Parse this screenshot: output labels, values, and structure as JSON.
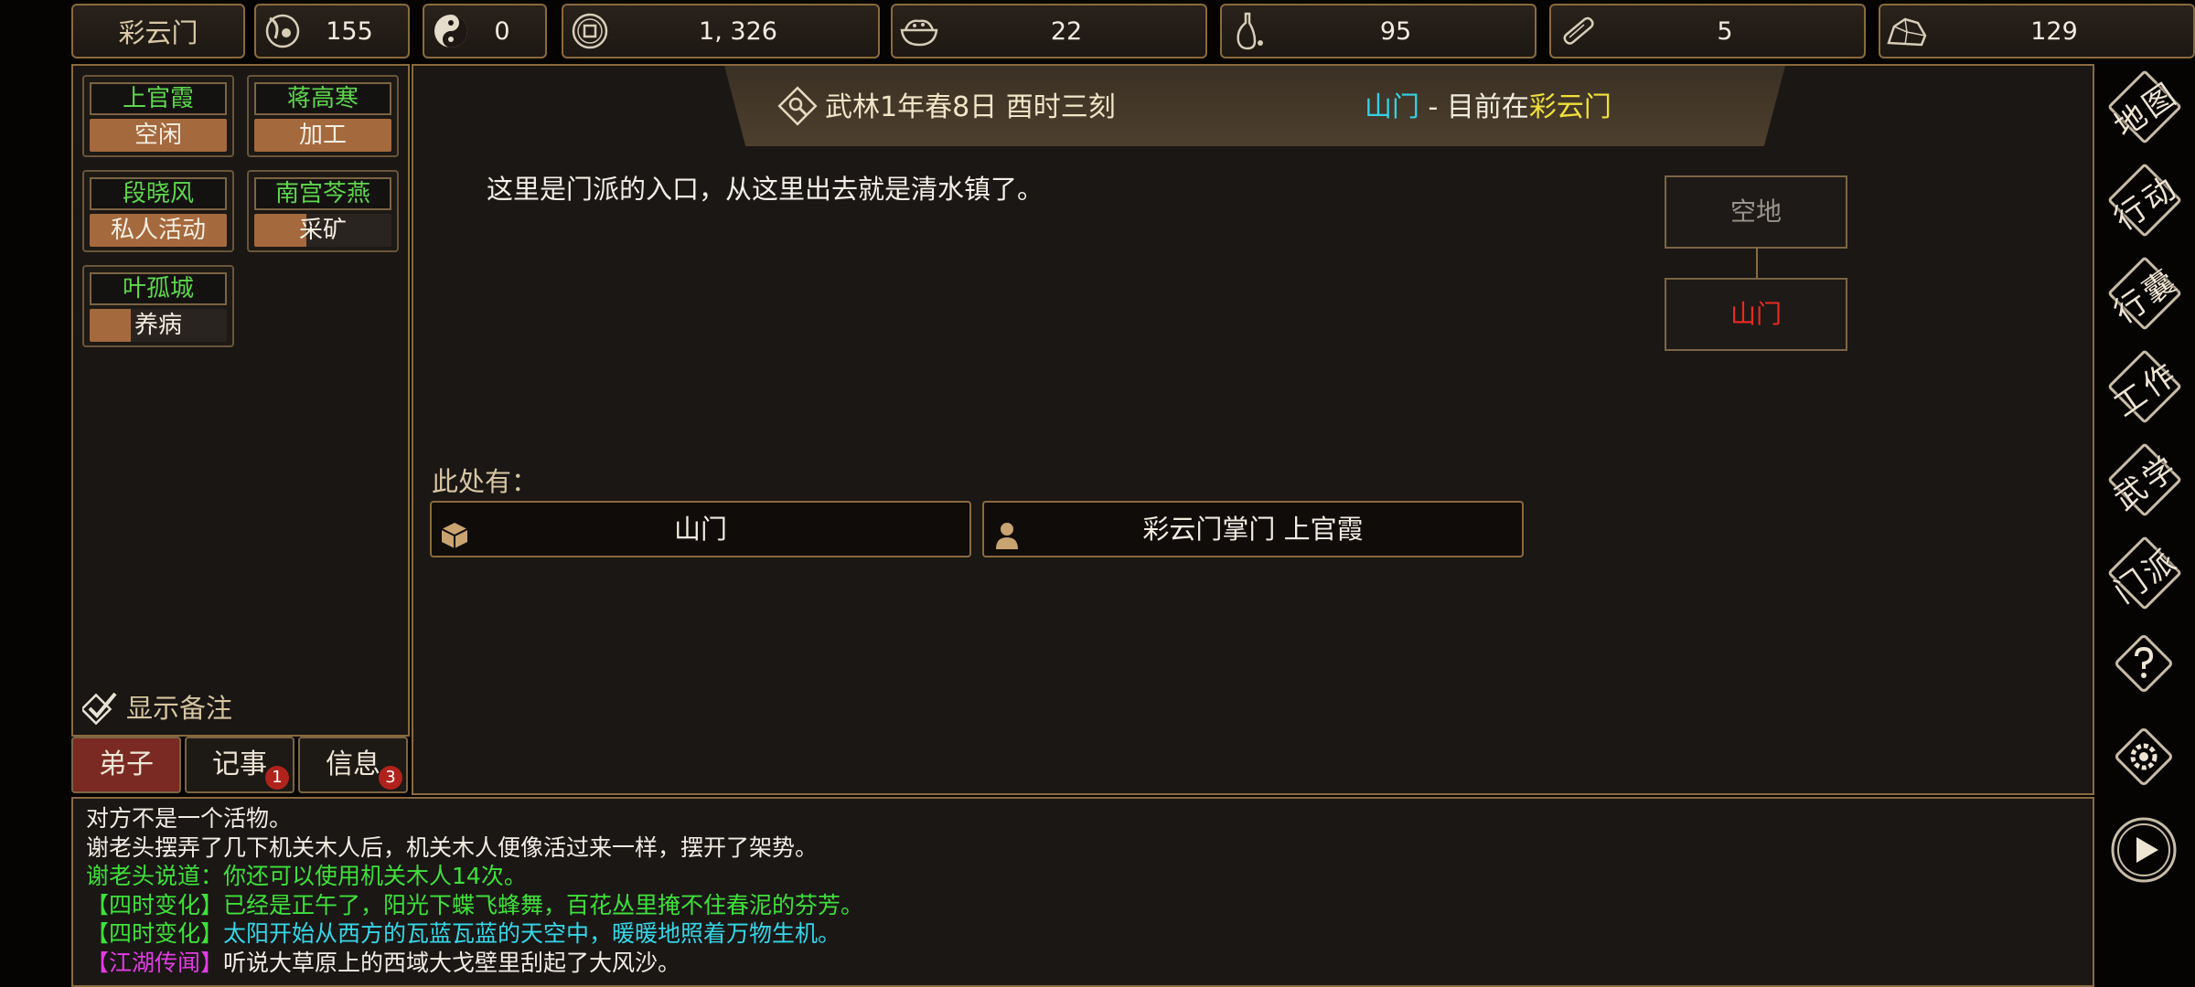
{
  "top_bar": {
    "sect_name": "彩云门",
    "resources": [
      {
        "icon": "prestige-icon",
        "value": "155"
      },
      {
        "icon": "yin-yang-icon",
        "value": "0"
      },
      {
        "icon": "coin-icon",
        "value": "1, 326"
      },
      {
        "icon": "food-bowl-icon",
        "value": "22"
      },
      {
        "icon": "herb-gourd-icon",
        "value": "95"
      },
      {
        "icon": "wood-log-icon",
        "value": "5"
      },
      {
        "icon": "ore-stone-icon",
        "value": "129"
      }
    ]
  },
  "disciples": [
    {
      "name": "上官霞",
      "task": "空闲"
    },
    {
      "name": "蒋高寒",
      "task": "加工"
    },
    {
      "name": "段晓风",
      "task": "私人活动"
    },
    {
      "name": "南宫芩燕",
      "task": "采矿"
    },
    {
      "name": "叶孤城",
      "task": "养病"
    }
  ],
  "show_notes_label": "显示备注",
  "bottom_tabs": [
    {
      "label": "弟子",
      "badge": ""
    },
    {
      "label": "记事",
      "badge": "1"
    },
    {
      "label": "信息",
      "badge": "3"
    }
  ],
  "banner": {
    "time": "武林1年春8日 酉时三刻",
    "location": "山门",
    "separator": " - 目前在",
    "sect": "彩云门"
  },
  "description": "这里是门派的入口，从这里出去就是清水镇了。",
  "mini_map": {
    "upper": "空地",
    "current": "山门"
  },
  "here_label": "此处有：",
  "entities": [
    {
      "label": "山门",
      "icon": "box-icon"
    },
    {
      "label": "彩云门掌门 上官霞",
      "icon": "person-icon"
    }
  ],
  "log": [
    {
      "segments": [
        {
          "text": "对方不是一个活物。",
          "color": "#f2ede3"
        }
      ]
    },
    {
      "segments": [
        {
          "text": "谢老头摆弄了几下机关木人后，机关木人便像活过来一样，摆开了架势。",
          "color": "#f2ede3"
        }
      ]
    },
    {
      "segments": [
        {
          "text": "谢老头说道：你还可以使用机关木人14次。",
          "color": "#3fe03a"
        }
      ]
    },
    {
      "segments": [
        {
          "text": "【四时变化】已经是正午了，阳光下蝶飞蜂舞，百花丛里掩不住春泥的芬芳。",
          "color": "#3fe03a"
        }
      ]
    },
    {
      "segments": [
        {
          "text": "【四时变化】",
          "color": "#3fe03a"
        },
        {
          "text": "太阳开始从西方的瓦蓝瓦蓝的天空中，暖暖地照着万物生机。",
          "color": "#35d7e8"
        }
      ]
    },
    {
      "segments": [
        {
          "text": "【江湖传闻】",
          "color": "#e23ce4"
        },
        {
          "text": "听说大草原上的西域大戈壁里刮起了大风沙。",
          "color": "#f2ede3"
        }
      ]
    }
  ],
  "right_nav": [
    "地图",
    "行动",
    "行囊",
    "工作",
    "武学",
    "门派"
  ],
  "colors": {
    "frame": "#8a6a3e",
    "disciple_name": "#5ed64d",
    "task_fill": "#a5693e",
    "location_highlight": "#35d2e6",
    "sect_highlight": "#f0e03a",
    "current_node": "#e82b22"
  }
}
